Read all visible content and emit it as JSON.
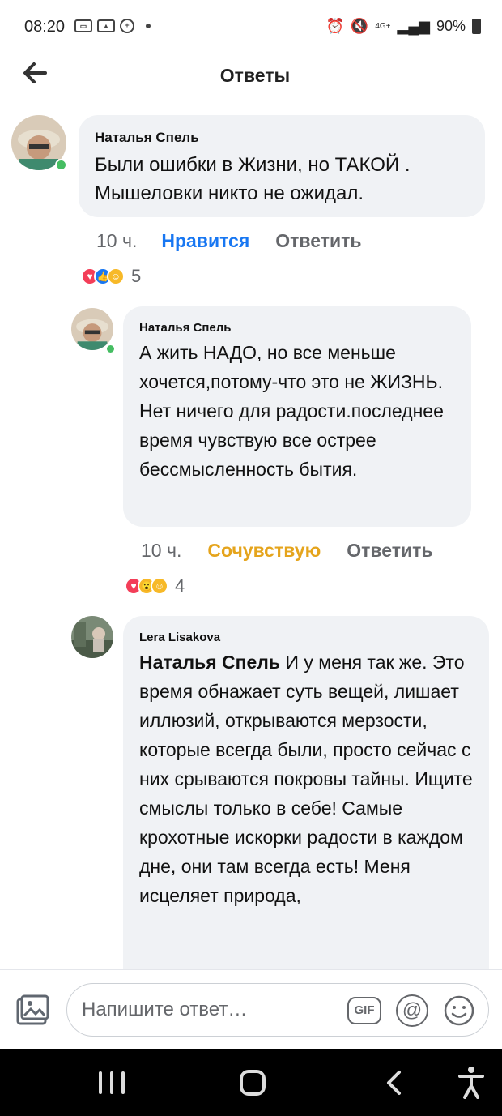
{
  "status_bar": {
    "time": "08:20",
    "left_icons": [
      "message-icon",
      "image-icon",
      "vpn-icon",
      "dot-icon"
    ],
    "network": "4G+",
    "battery": "90%"
  },
  "header": {
    "title": "Ответы"
  },
  "comments": [
    {
      "author": "Наталья Спель",
      "text": "Были ошибки в Жизни, но ТАКОЙ . Мышеловки никто не ожидал.",
      "time": "10 ч.",
      "reaction_label": "Нравится",
      "reply_label": "Ответить",
      "reaction_count": "5",
      "reactions": [
        "love",
        "like",
        "care"
      ]
    },
    {
      "author": "Наталья Спель",
      "text": "А жить НАДО, но все меньше хочется,потому-что это не ЖИЗНЬ. Нет ничего для радости.последнее время чувствую все острее бессмысленность бытия.",
      "time": "10 ч.",
      "reaction_label": "Сочувствую",
      "reply_label": "Ответить",
      "reaction_count": "4",
      "reactions": [
        "love",
        "wow",
        "care"
      ]
    },
    {
      "author": "Lera Lisakova",
      "mention": "Наталья Спель",
      "text": "И у меня так же. Это время обнажает суть вещей, лишает иллюзий, открываются мерзости, которые всегда были, просто сейчас с них срываются покровы тайны. Ищите смыслы только в себе! Самые крохотные искорки радости в каждом дне, они там всегда есть! Меня исцеляет природа,"
    }
  ],
  "composer": {
    "placeholder": "Напишите ответ…",
    "gif_label": "GIF",
    "at_label": "@"
  },
  "colors": {
    "like_blue": "#1877f2",
    "care_yellow": "#e5a41c",
    "bubble_gray": "#f0f2f5",
    "online_green": "#45bd62"
  }
}
